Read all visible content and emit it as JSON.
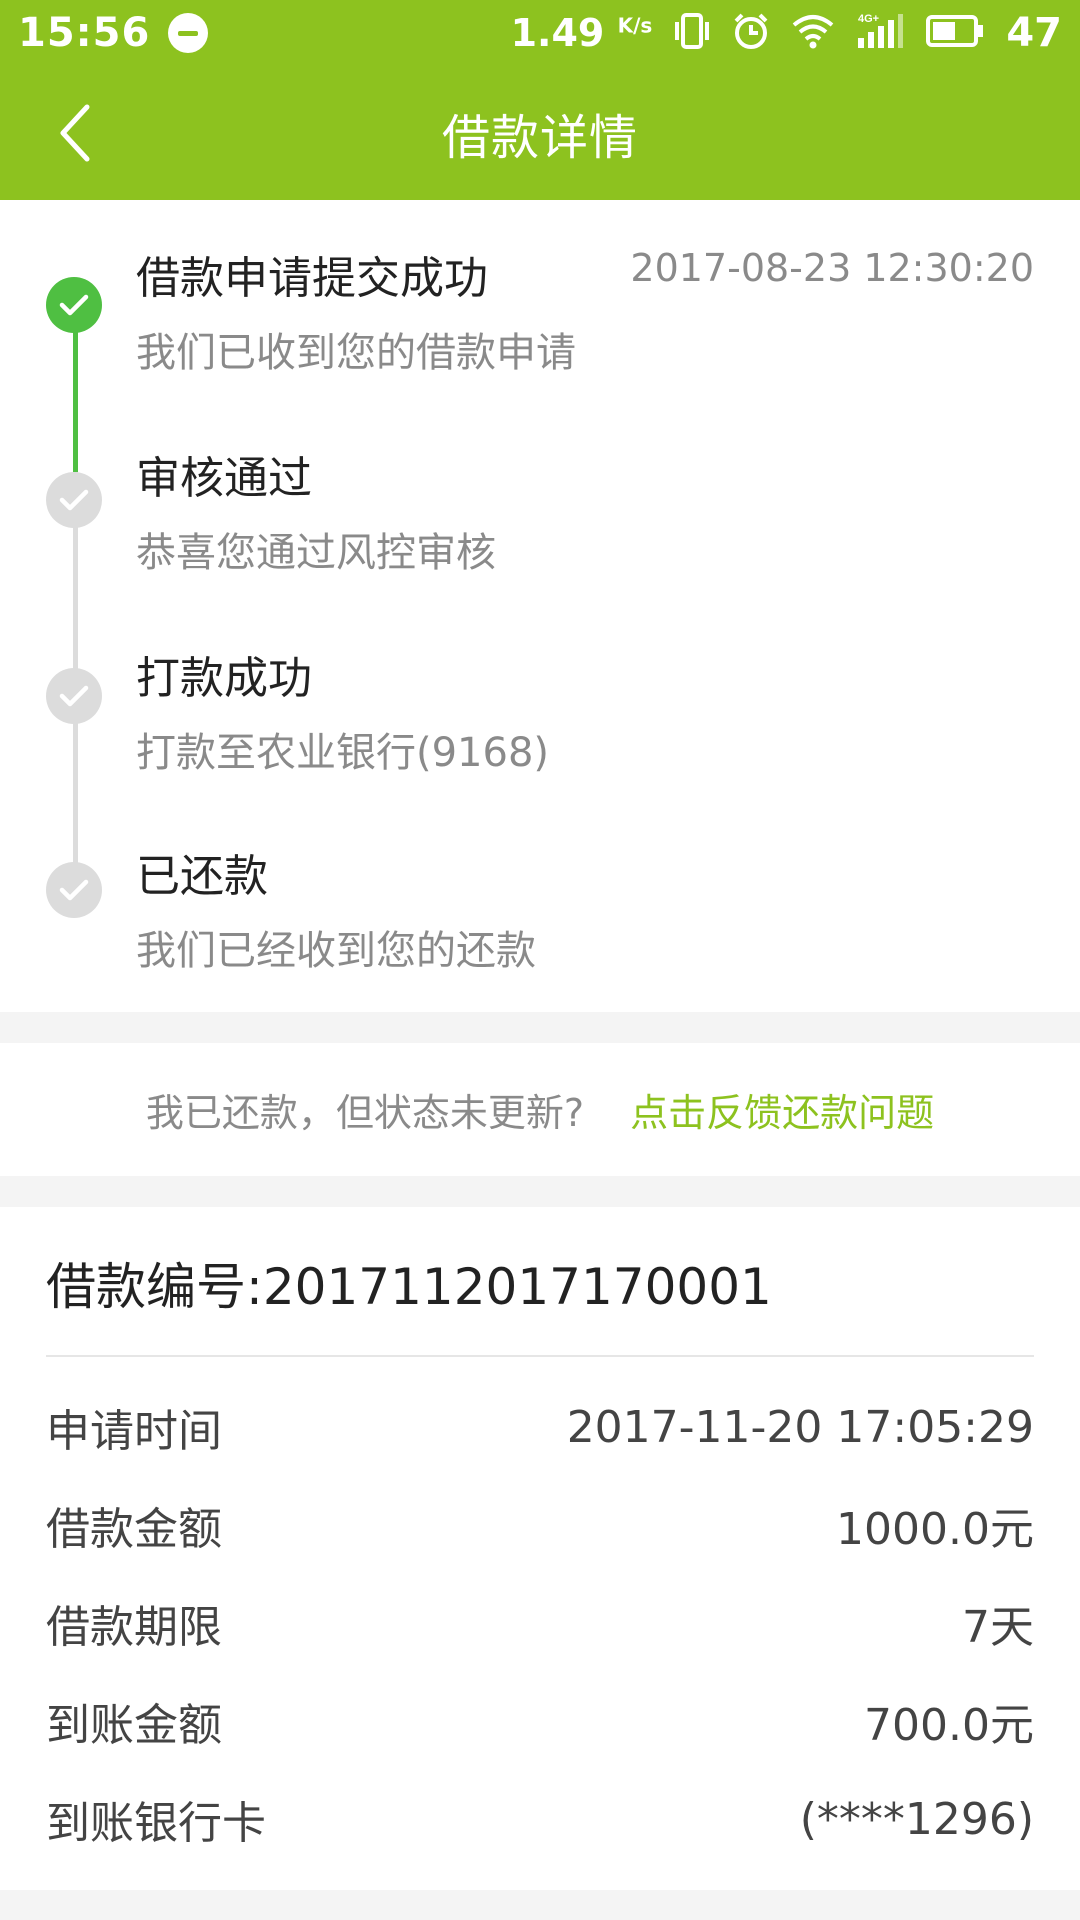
{
  "status_bar": {
    "time": "15:56",
    "speed": "1.49",
    "speed_unit": "K/s",
    "network": "4G",
    "battery": "47"
  },
  "header": {
    "title": "借款详情",
    "back_icon": "chevron-left-icon"
  },
  "timeline": {
    "steps": [
      {
        "title": "借款申请提交成功",
        "subtitle": "我们已收到您的借款申请",
        "time": "2017-08-23 12:30:20",
        "done": true
      },
      {
        "title": "审核通过",
        "subtitle": "恭喜您通过风控审核",
        "done": false
      },
      {
        "title": "打款成功",
        "subtitle": "打款至农业银行(9168)",
        "done": false
      },
      {
        "title": "已还款",
        "subtitle": "我们已经收到您的还款",
        "done": false
      }
    ]
  },
  "feedback": {
    "question": "我已还款，但状态未更新?",
    "link": "点击反馈还款问题"
  },
  "details": {
    "loan_number": "借款编号:2017112017170001",
    "rows": [
      {
        "label": "申请时间",
        "value": "2017-11-20 17:05:29"
      },
      {
        "label": "借款金额",
        "value": "1000.0元"
      },
      {
        "label": "借款期限",
        "value": "7天"
      },
      {
        "label": "到账金额",
        "value": "700.0元"
      },
      {
        "label": "到账银行卡",
        "value": "(****1296)"
      }
    ]
  },
  "colors": {
    "brand": "#8dc21f",
    "done": "#4fbf42",
    "pending": "#dcdcdc"
  }
}
